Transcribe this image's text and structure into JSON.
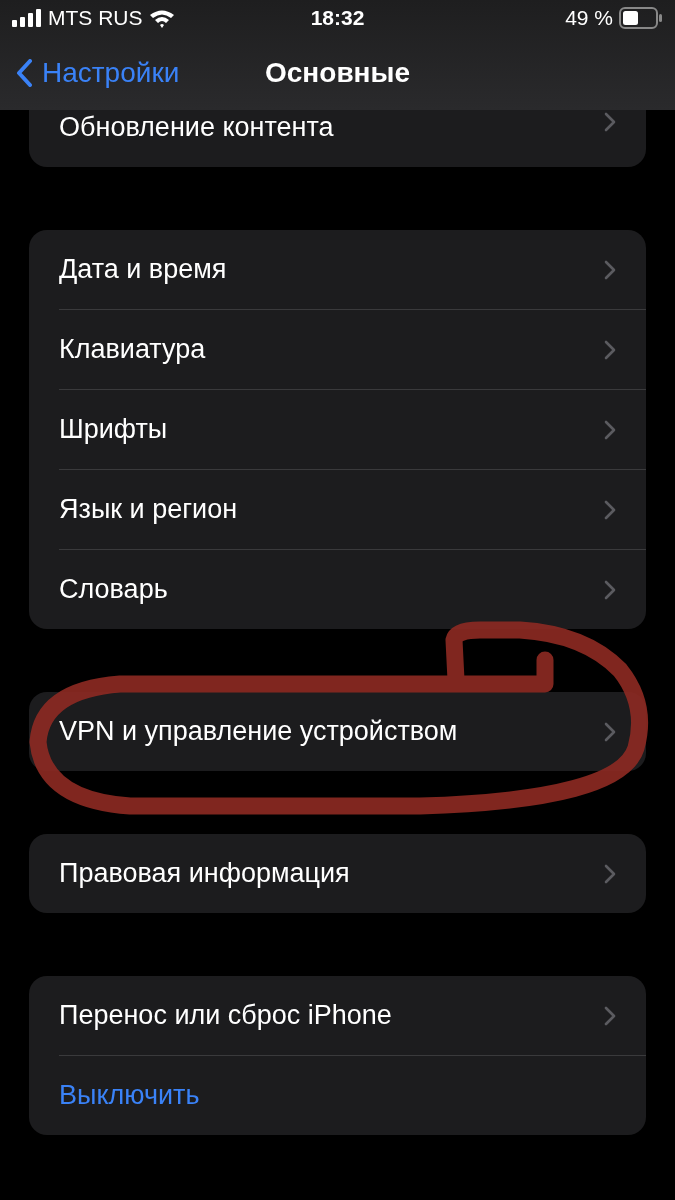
{
  "status_bar": {
    "carrier": "MTS RUS",
    "time": "18:32",
    "battery": "49 %"
  },
  "nav": {
    "back": "Настройки",
    "title": "Основные"
  },
  "groups": [
    {
      "partial": true,
      "items": [
        {
          "label": "Обновление контента",
          "kind": "link"
        }
      ]
    },
    {
      "partial": false,
      "items": [
        {
          "label": "Дата и время",
          "kind": "link"
        },
        {
          "label": "Клавиатура",
          "kind": "link"
        },
        {
          "label": "Шрифты",
          "kind": "link"
        },
        {
          "label": "Язык и регион",
          "kind": "link"
        },
        {
          "label": "Словарь",
          "kind": "link"
        }
      ]
    },
    {
      "partial": false,
      "items": [
        {
          "label": "VPN и управление устройством",
          "kind": "link"
        }
      ]
    },
    {
      "partial": false,
      "items": [
        {
          "label": "Правовая информация",
          "kind": "link"
        }
      ]
    },
    {
      "partial": false,
      "items": [
        {
          "label": "Перенос или сброс iPhone",
          "kind": "link"
        },
        {
          "label": "Выключить",
          "kind": "action"
        }
      ]
    }
  ]
}
